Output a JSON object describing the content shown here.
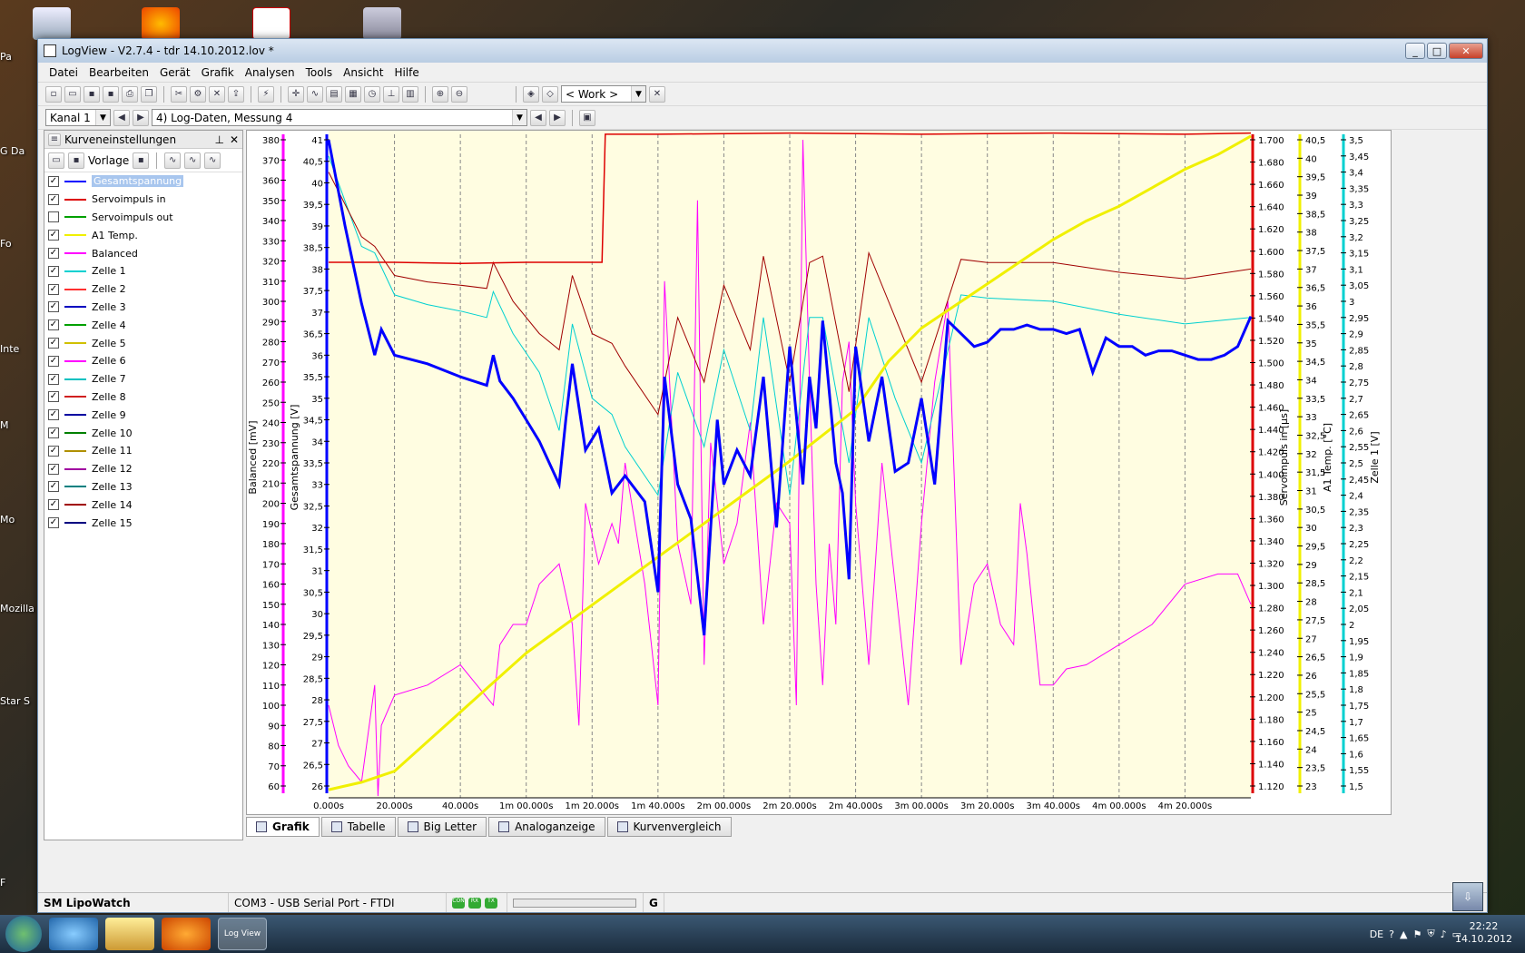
{
  "window": {
    "title": "LogView - V2.7.4 - tdr 14.10.2012.lov *",
    "btn_min": "_",
    "btn_max": "□",
    "btn_close": "✕"
  },
  "menu": [
    "Datei",
    "Bearbeiten",
    "Gerät",
    "Grafik",
    "Analysen",
    "Tools",
    "Ansicht",
    "Hilfe"
  ],
  "toolbar": {
    "workspace": "< Work >"
  },
  "toolbar2": {
    "channel": "Kanal 1",
    "dataset": "4) Log-Daten, Messung 4"
  },
  "panel": {
    "title": "Kurveneinstellungen",
    "vorlage": "Vorlage",
    "curves": [
      {
        "name": "Gesamtspannung",
        "checked": true,
        "color": "#0000ff",
        "selected": true
      },
      {
        "name": "Servoimpuls in",
        "checked": true,
        "color": "#dd0000"
      },
      {
        "name": "Servoimpuls out",
        "checked": false,
        "color": "#00a000"
      },
      {
        "name": "A1 Temp.",
        "checked": true,
        "color": "#f0f000"
      },
      {
        "name": "Balanced",
        "checked": true,
        "color": "#ff00ff"
      },
      {
        "name": "Zelle 1",
        "checked": true,
        "color": "#00d0d0"
      },
      {
        "name": "Zelle 2",
        "checked": true,
        "color": "#ff3030"
      },
      {
        "name": "Zelle 3",
        "checked": true,
        "color": "#0000c0"
      },
      {
        "name": "Zelle 4",
        "checked": true,
        "color": "#00a000"
      },
      {
        "name": "Zelle 5",
        "checked": true,
        "color": "#d0c000"
      },
      {
        "name": "Zelle 6",
        "checked": true,
        "color": "#ff00ff"
      },
      {
        "name": "Zelle 7",
        "checked": true,
        "color": "#00c0c0"
      },
      {
        "name": "Zelle 8",
        "checked": true,
        "color": "#d02020"
      },
      {
        "name": "Zelle 9",
        "checked": true,
        "color": "#0000a0"
      },
      {
        "name": "Zelle 10",
        "checked": true,
        "color": "#008000"
      },
      {
        "name": "Zelle 11",
        "checked": true,
        "color": "#b09000"
      },
      {
        "name": "Zelle 12",
        "checked": true,
        "color": "#a000a0"
      },
      {
        "name": "Zelle 13",
        "checked": true,
        "color": "#008080"
      },
      {
        "name": "Zelle 14",
        "checked": true,
        "color": "#a00000"
      },
      {
        "name": "Zelle 15",
        "checked": true,
        "color": "#000080"
      }
    ]
  },
  "tabs": [
    "Grafik",
    "Tabelle",
    "Big Letter",
    "Analoganzeige",
    "Kurvenvergleich"
  ],
  "status": {
    "device": "SM LipoWatch",
    "port": "COM3 - USB Serial Port - FTDI",
    "leds": [
      "CON",
      "RX",
      "TX"
    ],
    "flag": "G"
  },
  "taskbar": {
    "lang": "DE",
    "time": "22:22",
    "date": "14.10.2012",
    "app_label": "Log View"
  },
  "desktop": [
    "Pa",
    "G Da",
    "Fo",
    "Inte",
    "M",
    "Mo",
    "Mozilla",
    "Star S",
    "F"
  ],
  "chart_data": {
    "type": "line",
    "x_ticks": [
      "0.000s",
      "20.000s",
      "40.000s",
      "1m 00.000s",
      "1m 20.000s",
      "1m 40.000s",
      "2m 00.000s",
      "2m 20.000s",
      "2m 40.000s",
      "3m 00.000s",
      "3m 20.000s",
      "3m 40.000s",
      "4m 00.000s",
      "4m 20.000s"
    ],
    "xlim": [
      0,
      280
    ],
    "axes": [
      {
        "label": "Balanced [mV]",
        "ticks": [
          "380",
          "370",
          "360",
          "350",
          "340",
          "330",
          "320",
          "310",
          "300",
          "290",
          "280",
          "270",
          "260",
          "250",
          "240",
          "230",
          "220",
          "210",
          "200",
          "190",
          "180",
          "170",
          "160",
          "150",
          "140",
          "130",
          "120",
          "110",
          "100",
          "90",
          "80",
          "70",
          "60"
        ]
      },
      {
        "label": "Gesamtspannung [V]",
        "ticks": [
          "41",
          "40,5",
          "40",
          "39,5",
          "39",
          "38,5",
          "38",
          "37,5",
          "37",
          "36,5",
          "36",
          "35,5",
          "35",
          "34,5",
          "34",
          "33,5",
          "33",
          "32,5",
          "32",
          "31,5",
          "31",
          "30,5",
          "30",
          "29,5",
          "29",
          "28,5",
          "28",
          "27,5",
          "27",
          "26,5",
          "26"
        ]
      },
      {
        "label": "Servoimpuls in [µs]",
        "ticks": [
          "1.700",
          "1.680",
          "1.660",
          "1.640",
          "1.620",
          "1.600",
          "1.580",
          "1.560",
          "1.540",
          "1.520",
          "1.500",
          "1.480",
          "1.460",
          "1.440",
          "1.420",
          "1.400",
          "1.380",
          "1.360",
          "1.340",
          "1.320",
          "1.300",
          "1.280",
          "1.260",
          "1.240",
          "1.220",
          "1.200",
          "1.180",
          "1.160",
          "1.140",
          "1.120"
        ]
      },
      {
        "label": "A1 Temp. [°C]",
        "ticks": [
          "40,5",
          "40",
          "39,5",
          "39",
          "38,5",
          "38",
          "37,5",
          "37",
          "36,5",
          "36",
          "35,5",
          "35",
          "34,5",
          "34",
          "33,5",
          "33",
          "32,5",
          "32",
          "31,5",
          "31",
          "30,5",
          "30",
          "29,5",
          "29",
          "28,5",
          "28",
          "27,5",
          "27",
          "26,5",
          "26",
          "25,5",
          "25",
          "24,5",
          "24",
          "23,5",
          "23"
        ]
      },
      {
        "label": "Zelle 1 [V]",
        "ticks": [
          "3,5",
          "3,45",
          "3,4",
          "3,35",
          "3,3",
          "3,25",
          "3,2",
          "3,15",
          "3,1",
          "3,05",
          "3",
          "2,95",
          "2,9",
          "2,85",
          "2,8",
          "2,75",
          "2,7",
          "2,65",
          "2,6",
          "2,55",
          "2,5",
          "2,45",
          "2,4",
          "2,35",
          "2,3",
          "2,25",
          "2,2",
          "2,15",
          "2,1",
          "2,05",
          "2",
          "1,95",
          "1,9",
          "1,85",
          "1,8",
          "1,75",
          "1,7",
          "1,65",
          "1,6",
          "1,55",
          "1,5"
        ]
      }
    ],
    "series": [
      {
        "name": "Gesamtspannung",
        "color": "#0000ff",
        "x": [
          0,
          5,
          10,
          14,
          16,
          20,
          30,
          40,
          48,
          50,
          52,
          56,
          60,
          64,
          70,
          72,
          74,
          78,
          82,
          86,
          90,
          96,
          100,
          102,
          106,
          110,
          114,
          118,
          120,
          124,
          128,
          132,
          136,
          140,
          144,
          146,
          148,
          150,
          154,
          156,
          158,
          160,
          164,
          168,
          172,
          176,
          180,
          184,
          188,
          192,
          196,
          200,
          204,
          208,
          212,
          216,
          220,
          224,
          228,
          232,
          236,
          240,
          244,
          248,
          252,
          256,
          260,
          264,
          268,
          272,
          276,
          280
        ],
        "y": [
          41,
          39,
          37.2,
          36,
          36.6,
          36,
          35.8,
          35.5,
          35.3,
          36,
          35.4,
          35,
          34.5,
          34,
          33,
          34.5,
          35.8,
          33.8,
          34.3,
          32.8,
          33.2,
          32.6,
          30.5,
          35.5,
          33,
          32.2,
          29.5,
          34.5,
          33,
          33.8,
          33.2,
          35.5,
          32,
          36.2,
          33,
          35.5,
          34.3,
          36.8,
          33.5,
          32.8,
          30.8,
          36.2,
          34,
          35.5,
          33.3,
          33.5,
          35,
          33,
          36.8,
          36.5,
          36.2,
          36.3,
          36.6,
          36.6,
          36.7,
          36.6,
          36.6,
          36.5,
          36.6,
          35.6,
          36.4,
          36.2,
          36.2,
          36,
          36.1,
          36.1,
          36,
          35.9,
          35.9,
          36,
          36.2,
          36.9
        ]
      },
      {
        "name": "Servoimpuls in",
        "color": "#dd0000",
        "x": [
          0,
          20,
          40,
          60,
          80,
          83,
          84,
          100,
          140,
          180,
          220,
          260,
          280
        ],
        "y": [
          1.59,
          1.59,
          1.589,
          1.59,
          1.59,
          1.59,
          1.705,
          1.705,
          1.706,
          1.705,
          1.706,
          1.705,
          1.706
        ]
      },
      {
        "name": "A1 Temp.",
        "color": "#f0f000",
        "x": [
          0,
          10,
          20,
          40,
          60,
          80,
          100,
          120,
          140,
          160,
          170,
          180,
          190,
          200,
          210,
          220,
          230,
          240,
          250,
          260,
          270,
          280
        ],
        "y": [
          22.9,
          23.1,
          23.4,
          25,
          26.6,
          27.9,
          29.2,
          30.5,
          31.8,
          33.2,
          34.5,
          35.4,
          36,
          36.6,
          37.2,
          37.8,
          38.3,
          38.7,
          39.2,
          39.7,
          40.1,
          40.6
        ]
      },
      {
        "name": "Balanced",
        "color": "#ff00ff",
        "x": [
          0,
          3,
          6,
          10,
          14,
          15,
          16,
          20,
          30,
          40,
          50,
          52,
          56,
          60,
          64,
          70,
          74,
          76,
          78,
          82,
          86,
          88,
          90,
          96,
          100,
          102,
          106,
          110,
          112,
          114,
          116,
          118,
          120,
          124,
          128,
          132,
          136,
          140,
          142,
          144,
          146,
          148,
          150,
          152,
          154,
          156,
          158,
          160,
          164,
          168,
          172,
          176,
          180,
          184,
          188,
          192,
          196,
          200,
          204,
          208,
          210,
          212,
          216,
          220,
          224,
          230,
          240,
          250,
          260,
          270,
          276,
          280
        ],
        "y": [
          100,
          80,
          70,
          62,
          110,
          55,
          90,
          105,
          110,
          120,
          100,
          130,
          140,
          140,
          160,
          170,
          140,
          90,
          200,
          170,
          190,
          180,
          220,
          160,
          100,
          310,
          180,
          150,
          350,
          120,
          230,
          200,
          170,
          190,
          240,
          140,
          200,
          190,
          100,
          380,
          260,
          160,
          110,
          180,
          140,
          260,
          280,
          200,
          120,
          220,
          160,
          100,
          190,
          260,
          300,
          120,
          160,
          170,
          140,
          130,
          200,
          175,
          110,
          110,
          118,
          120,
          130,
          140,
          160,
          165,
          165,
          150
        ]
      },
      {
        "name": "Zelle 1",
        "color": "#00d0d0",
        "x": [
          0,
          10,
          14,
          20,
          30,
          40,
          48,
          50,
          56,
          64,
          70,
          74,
          80,
          86,
          90,
          100,
          106,
          114,
          120,
          128,
          132,
          140,
          146,
          150,
          158,
          164,
          172,
          180,
          192,
          200,
          220,
          240,
          260,
          280
        ],
        "y": [
          3.45,
          3.17,
          3.15,
          3.02,
          2.99,
          2.97,
          2.95,
          3.03,
          2.9,
          2.78,
          2.6,
          2.93,
          2.7,
          2.65,
          2.55,
          2.4,
          2.78,
          2.55,
          2.85,
          2.6,
          2.95,
          2.4,
          2.95,
          2.95,
          2.5,
          2.95,
          2.7,
          2.5,
          3.02,
          3.01,
          3.0,
          2.96,
          2.93,
          2.95
        ]
      },
      {
        "name": "Zelle 14",
        "color": "#a00000",
        "x": [
          0,
          10,
          14,
          20,
          30,
          40,
          48,
          50,
          56,
          64,
          70,
          74,
          80,
          86,
          90,
          100,
          106,
          114,
          120,
          128,
          132,
          140,
          146,
          150,
          158,
          164,
          172,
          180,
          192,
          200,
          220,
          240,
          260,
          280
        ],
        "y": [
          3.4,
          3.2,
          3.17,
          3.08,
          3.06,
          3.05,
          3.04,
          3.12,
          3.0,
          2.9,
          2.85,
          3.08,
          2.9,
          2.87,
          2.8,
          2.65,
          2.95,
          2.75,
          3.05,
          2.85,
          3.14,
          2.75,
          3.12,
          3.14,
          2.72,
          3.15,
          2.95,
          2.75,
          3.13,
          3.12,
          3.12,
          3.09,
          3.07,
          3.1
        ]
      }
    ]
  }
}
